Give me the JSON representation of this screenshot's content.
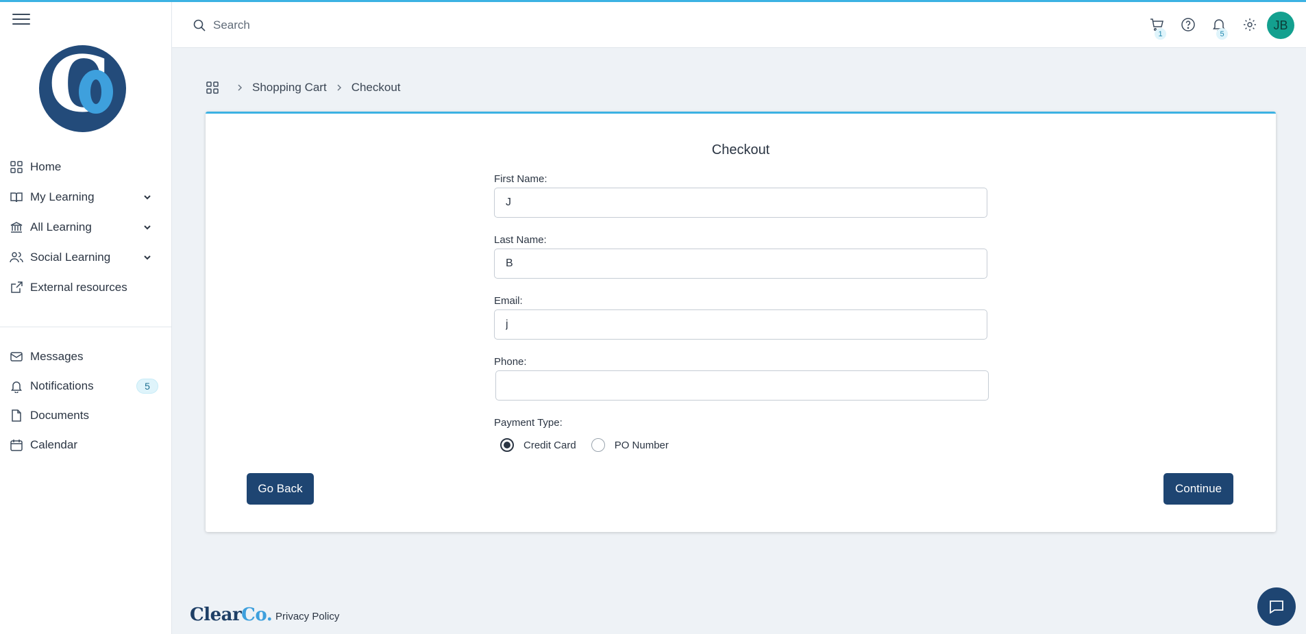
{
  "header": {
    "search_placeholder": "Search",
    "cart_count": "1",
    "notification_count": "5",
    "avatar_initials": "JB"
  },
  "sidebar": {
    "main_items": [
      {
        "label": "Home",
        "icon": "grid-icon"
      },
      {
        "label": "My Learning",
        "icon": "book-icon",
        "expandable": true
      },
      {
        "label": "All Learning",
        "icon": "bank-icon",
        "expandable": true
      },
      {
        "label": "Social Learning",
        "icon": "users-icon",
        "expandable": true
      },
      {
        "label": "External resources",
        "icon": "external-link-icon"
      }
    ],
    "secondary_items": [
      {
        "label": "Messages",
        "icon": "mail-icon"
      },
      {
        "label": "Notifications",
        "icon": "bell-icon",
        "badge": "5"
      },
      {
        "label": "Documents",
        "icon": "file-icon"
      },
      {
        "label": "Calendar",
        "icon": "calendar-icon"
      }
    ]
  },
  "breadcrumb": {
    "items": [
      "Shopping Cart",
      "Checkout"
    ]
  },
  "checkout": {
    "title": "Checkout",
    "first_name_label": "First Name:",
    "first_name_value": "J",
    "last_name_label": "Last Name:",
    "last_name_value": "B",
    "email_label": "Email:",
    "email_value": "j",
    "phone_label": "Phone:",
    "phone_value": "",
    "payment_label": "Payment Type:",
    "payment_options": [
      "Credit Card",
      "PO Number"
    ],
    "payment_selected": "Credit Card",
    "back_label": "Go Back",
    "continue_label": "Continue"
  },
  "footer": {
    "logo_text_main": "Clear",
    "logo_text_accent": "Co.",
    "privacy_label": "Privacy Policy"
  },
  "colors": {
    "accent": "#3cb2e3",
    "primary": "#1e4572",
    "avatar": "#13a08f"
  }
}
